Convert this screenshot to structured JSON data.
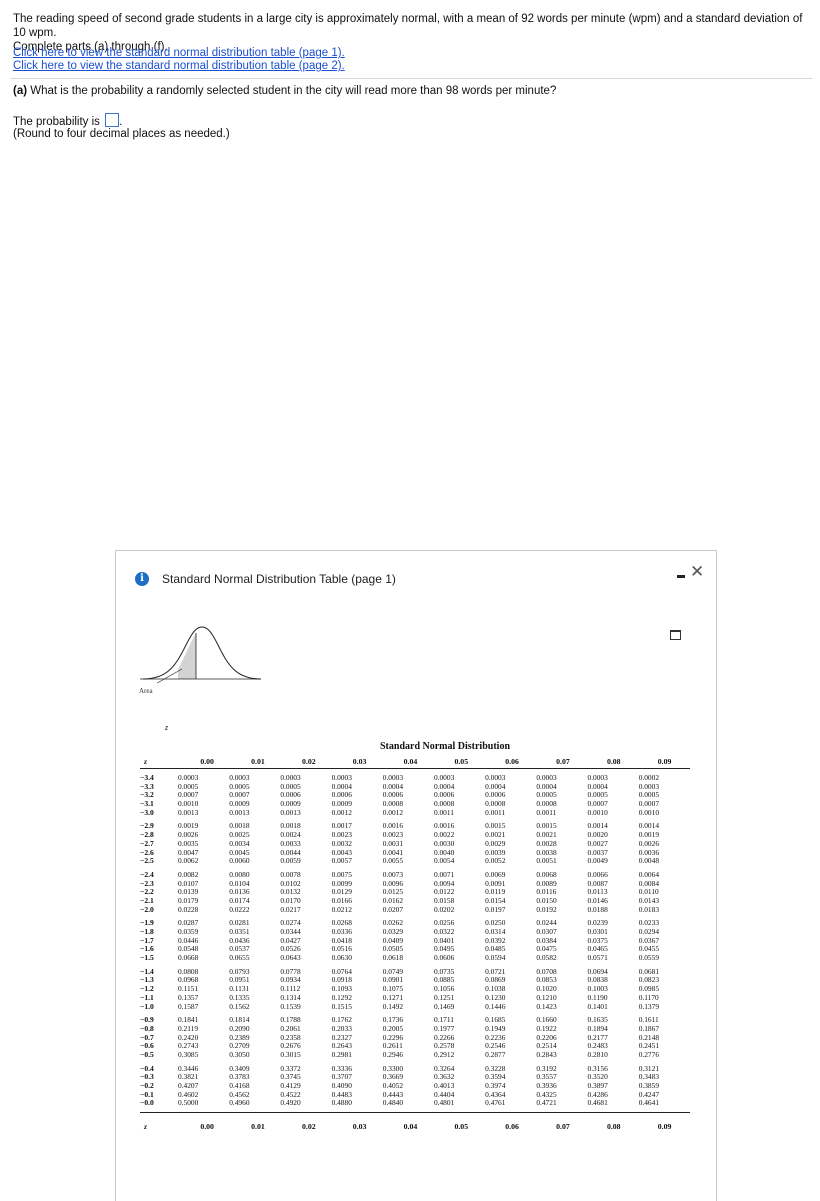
{
  "problem": {
    "intro_line1": "The reading speed of second grade students in a large city is approximately normal, with a mean of 92 words per minute (wpm) and a standard deviation of 10 wpm.",
    "intro_line2": "Complete parts (a) through (f).",
    "link1": "Click here to view the standard normal distribution table (page 1).",
    "link2": "Click here to view the standard normal distribution table (page 2).",
    "part_a_label": "(a)",
    "part_a_question": "What is the probability a randomly selected student in the city will read more than 98 words per minute?",
    "answer_prefix": "The probability is",
    "answer_suffix": ".",
    "answer_value": "",
    "note": "(Round to four decimal places as needed.)"
  },
  "dialog": {
    "info_icon": "i",
    "title": "Standard Normal Distribution Table (page 1)",
    "minimize_icon": "minimize-icon",
    "close_icon": "✕",
    "print_icon": "print-icon",
    "area_label": "Area",
    "z_label": "z",
    "accent_color": "#1c6fc4"
  },
  "table": {
    "title": "Standard Normal Distribution",
    "z_header": "z",
    "col_headers": [
      "0.00",
      "0.01",
      "0.02",
      "0.03",
      "0.04",
      "0.05",
      "0.06",
      "0.07",
      "0.08",
      "0.09"
    ],
    "groups": [
      [
        {
          "z": "−3.4",
          "v": [
            "0.0003",
            "0.0003",
            "0.0003",
            "0.0003",
            "0.0003",
            "0.0003",
            "0.0003",
            "0.0003",
            "0.0003",
            "0.0002"
          ]
        },
        {
          "z": "−3.3",
          "v": [
            "0.0005",
            "0.0005",
            "0.0005",
            "0.0004",
            "0.0004",
            "0.0004",
            "0.0004",
            "0.0004",
            "0.0004",
            "0.0003"
          ]
        },
        {
          "z": "−3.2",
          "v": [
            "0.0007",
            "0.0007",
            "0.0006",
            "0.0006",
            "0.0006",
            "0.0006",
            "0.0006",
            "0.0005",
            "0.0005",
            "0.0005"
          ]
        },
        {
          "z": "−3.1",
          "v": [
            "0.0010",
            "0.0009",
            "0.0009",
            "0.0009",
            "0.0008",
            "0.0008",
            "0.0008",
            "0.0008",
            "0.0007",
            "0.0007"
          ]
        },
        {
          "z": "−3.0",
          "v": [
            "0.0013",
            "0.0013",
            "0.0013",
            "0.0012",
            "0.0012",
            "0.0011",
            "0.0011",
            "0.0011",
            "0.0010",
            "0.0010"
          ]
        }
      ],
      [
        {
          "z": "−2.9",
          "v": [
            "0.0019",
            "0.0018",
            "0.0018",
            "0.0017",
            "0.0016",
            "0.0016",
            "0.0015",
            "0.0015",
            "0.0014",
            "0.0014"
          ]
        },
        {
          "z": "−2.8",
          "v": [
            "0.0026",
            "0.0025",
            "0.0024",
            "0.0023",
            "0.0023",
            "0.0022",
            "0.0021",
            "0.0021",
            "0.0020",
            "0.0019"
          ]
        },
        {
          "z": "−2.7",
          "v": [
            "0.0035",
            "0.0034",
            "0.0033",
            "0.0032",
            "0.0031",
            "0.0030",
            "0.0029",
            "0.0028",
            "0.0027",
            "0.0026"
          ]
        },
        {
          "z": "−2.6",
          "v": [
            "0.0047",
            "0.0045",
            "0.0044",
            "0.0043",
            "0.0041",
            "0.0040",
            "0.0039",
            "0.0038",
            "0.0037",
            "0.0036"
          ]
        },
        {
          "z": "−2.5",
          "v": [
            "0.0062",
            "0.0060",
            "0.0059",
            "0.0057",
            "0.0055",
            "0.0054",
            "0.0052",
            "0.0051",
            "0.0049",
            "0.0048"
          ]
        }
      ],
      [
        {
          "z": "−2.4",
          "v": [
            "0.0082",
            "0.0080",
            "0.0078",
            "0.0075",
            "0.0073",
            "0.0071",
            "0.0069",
            "0.0068",
            "0.0066",
            "0.0064"
          ]
        },
        {
          "z": "−2.3",
          "v": [
            "0.0107",
            "0.0104",
            "0.0102",
            "0.0099",
            "0.0096",
            "0.0094",
            "0.0091",
            "0.0089",
            "0.0087",
            "0.0084"
          ]
        },
        {
          "z": "−2.2",
          "v": [
            "0.0139",
            "0.0136",
            "0.0132",
            "0.0129",
            "0.0125",
            "0.0122",
            "0.0119",
            "0.0116",
            "0.0113",
            "0.0110"
          ]
        },
        {
          "z": "−2.1",
          "v": [
            "0.0179",
            "0.0174",
            "0.0170",
            "0.0166",
            "0.0162",
            "0.0158",
            "0.0154",
            "0.0150",
            "0.0146",
            "0.0143"
          ]
        },
        {
          "z": "−2.0",
          "v": [
            "0.0228",
            "0.0222",
            "0.0217",
            "0.0212",
            "0.0207",
            "0.0202",
            "0.0197",
            "0.0192",
            "0.0188",
            "0.0183"
          ]
        }
      ],
      [
        {
          "z": "−1.9",
          "v": [
            "0.0287",
            "0.0281",
            "0.0274",
            "0.0268",
            "0.0262",
            "0.0256",
            "0.0250",
            "0.0244",
            "0.0239",
            "0.0233"
          ]
        },
        {
          "z": "−1.8",
          "v": [
            "0.0359",
            "0.0351",
            "0.0344",
            "0.0336",
            "0.0329",
            "0.0322",
            "0.0314",
            "0.0307",
            "0.0301",
            "0.0294"
          ]
        },
        {
          "z": "−1.7",
          "v": [
            "0.0446",
            "0.0436",
            "0.0427",
            "0.0418",
            "0.0409",
            "0.0401",
            "0.0392",
            "0.0384",
            "0.0375",
            "0.0367"
          ]
        },
        {
          "z": "−1.6",
          "v": [
            "0.0548",
            "0.0537",
            "0.0526",
            "0.0516",
            "0.0505",
            "0.0495",
            "0.0485",
            "0.0475",
            "0.0465",
            "0.0455"
          ]
        },
        {
          "z": "−1.5",
          "v": [
            "0.0668",
            "0.0655",
            "0.0643",
            "0.0630",
            "0.0618",
            "0.0606",
            "0.0594",
            "0.0582",
            "0.0571",
            "0.0559"
          ]
        }
      ],
      [
        {
          "z": "−1.4",
          "v": [
            "0.0808",
            "0.0793",
            "0.0778",
            "0.0764",
            "0.0749",
            "0.0735",
            "0.0721",
            "0.0708",
            "0.0694",
            "0.0681"
          ]
        },
        {
          "z": "−1.3",
          "v": [
            "0.0968",
            "0.0951",
            "0.0934",
            "0.0918",
            "0.0901",
            "0.0885",
            "0.0869",
            "0.0853",
            "0.0838",
            "0.0823"
          ]
        },
        {
          "z": "−1.2",
          "v": [
            "0.1151",
            "0.1131",
            "0.1112",
            "0.1093",
            "0.1075",
            "0.1056",
            "0.1038",
            "0.1020",
            "0.1003",
            "0.0985"
          ]
        },
        {
          "z": "−1.1",
          "v": [
            "0.1357",
            "0.1335",
            "0.1314",
            "0.1292",
            "0.1271",
            "0.1251",
            "0.1230",
            "0.1210",
            "0.1190",
            "0.1170"
          ]
        },
        {
          "z": "−1.0",
          "v": [
            "0.1587",
            "0.1562",
            "0.1539",
            "0.1515",
            "0.1492",
            "0.1469",
            "0.1446",
            "0.1423",
            "0.1401",
            "0.1379"
          ]
        }
      ],
      [
        {
          "z": "−0.9",
          "v": [
            "0.1841",
            "0.1814",
            "0.1788",
            "0.1762",
            "0.1736",
            "0.1711",
            "0.1685",
            "0.1660",
            "0.1635",
            "0.1611"
          ]
        },
        {
          "z": "−0.8",
          "v": [
            "0.2119",
            "0.2090",
            "0.2061",
            "0.2033",
            "0.2005",
            "0.1977",
            "0.1949",
            "0.1922",
            "0.1894",
            "0.1867"
          ]
        },
        {
          "z": "−0.7",
          "v": [
            "0.2420",
            "0.2389",
            "0.2358",
            "0.2327",
            "0.2296",
            "0.2266",
            "0.2236",
            "0.2206",
            "0.2177",
            "0.2148"
          ]
        },
        {
          "z": "−0.6",
          "v": [
            "0.2743",
            "0.2709",
            "0.2676",
            "0.2643",
            "0.2611",
            "0.2578",
            "0.2546",
            "0.2514",
            "0.2483",
            "0.2451"
          ]
        },
        {
          "z": "−0.5",
          "v": [
            "0.3085",
            "0.3050",
            "0.3015",
            "0.2981",
            "0.2946",
            "0.2912",
            "0.2877",
            "0.2843",
            "0.2810",
            "0.2776"
          ]
        }
      ],
      [
        {
          "z": "−0.4",
          "v": [
            "0.3446",
            "0.3409",
            "0.3372",
            "0.3336",
            "0.3300",
            "0.3264",
            "0.3228",
            "0.3192",
            "0.3156",
            "0.3121"
          ]
        },
        {
          "z": "−0.3",
          "v": [
            "0.3821",
            "0.3783",
            "0.3745",
            "0.3707",
            "0.3669",
            "0.3632",
            "0.3594",
            "0.3557",
            "0.3520",
            "0.3483"
          ]
        },
        {
          "z": "−0.2",
          "v": [
            "0.4207",
            "0.4168",
            "0.4129",
            "0.4090",
            "0.4052",
            "0.4013",
            "0.3974",
            "0.3936",
            "0.3897",
            "0.3859"
          ]
        },
        {
          "z": "−0.1",
          "v": [
            "0.4602",
            "0.4562",
            "0.4522",
            "0.4483",
            "0.4443",
            "0.4404",
            "0.4364",
            "0.4325",
            "0.4286",
            "0.4247"
          ]
        },
        {
          "z": "−0.0",
          "v": [
            "0.5000",
            "0.4960",
            "0.4920",
            "0.4880",
            "0.4840",
            "0.4801",
            "0.4761",
            "0.4721",
            "0.4681",
            "0.4641"
          ]
        }
      ]
    ]
  }
}
